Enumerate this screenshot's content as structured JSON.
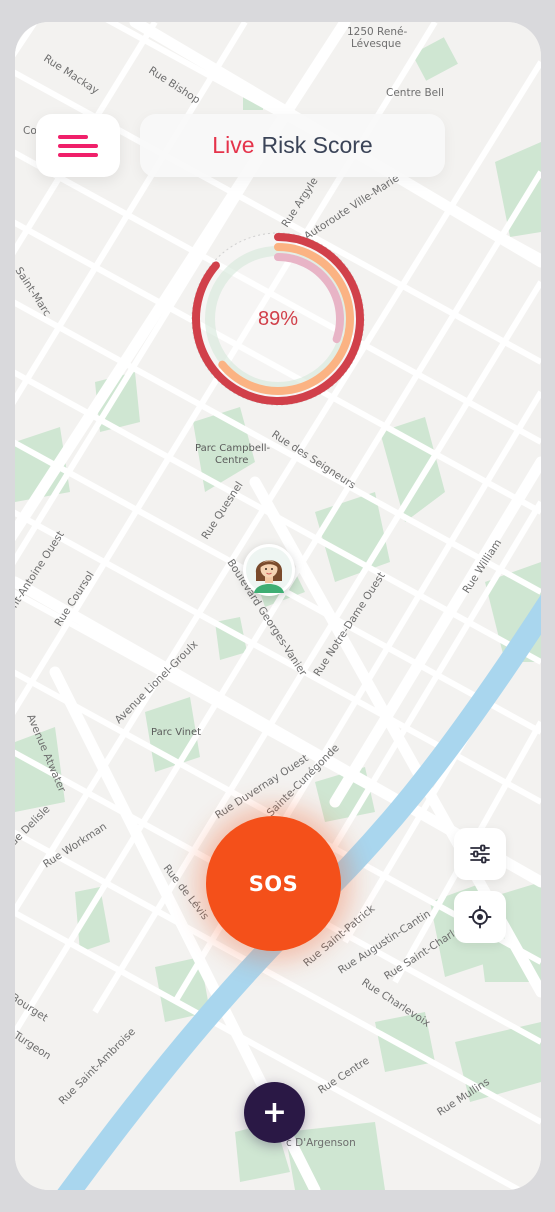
{
  "header": {
    "title_accent": "Live",
    "title_rest": "Risk Score"
  },
  "risk": {
    "value_label": "89%",
    "score_fraction": 0.89,
    "ring_colors": [
      "#d1404a",
      "#fbb383",
      "#e8b4c6"
    ]
  },
  "actions": {
    "sos_label": "SOS",
    "add_label": "+"
  },
  "colors": {
    "accent_pink": "#f0206a",
    "sos_orange": "#f4501a",
    "add_purple": "#2a1845",
    "water": "#a9d6ee",
    "park": "#cfe6d2"
  },
  "icons": {
    "menu": "menu-icon",
    "filter": "sliders-icon",
    "locate": "crosshair-icon",
    "avatar": "user-avatar"
  },
  "map": {
    "labels": {
      "l1250": "1250 René-",
      "levesque": "Lévesque",
      "mackay": "Rue Mackay",
      "bishop": "Rue Bishop",
      "centre_bell": "Centre Bell",
      "co": "Co",
      "argyle": "Rue Argyle",
      "ville_marie": "Autoroute Ville-Marie",
      "saint_marc": "Saint-Marc",
      "campbell1": "Parc Campbell-",
      "campbell2": "Centre",
      "seigneurs": "Rue des Seigneurs",
      "quesnel": "Rue Quesnel",
      "antoine": "Saint-Antoine Ouest",
      "coursol": "Rue Coursol",
      "georges_vanier": "Boulevard Georges-Vanier",
      "notre_dame": "Rue Notre-Dame Ouest",
      "william": "Rue William",
      "lionel_groulx": "Avenue Lionel-Groulx",
      "parc_vinet": "Parc Vinet",
      "atwater": "Avenue Atwater",
      "duvernay": "Rue Duvernay Ouest",
      "cunegonde": "Sainte-Cunégonde",
      "workman": "Rue Workman",
      "delisle": "Rue Delisle",
      "de_levis": "Rue de Lévis",
      "saint_patrick": "Rue Saint-Patrick",
      "augustin": "Rue Augustin-Cantin",
      "saint_charles": "Rue Saint-Charles",
      "charlevoix": "Rue Charlevoix",
      "bourget": "Bourget",
      "turgeon": "Turgeon",
      "saint_ambroise": "Rue Saint-Ambroise",
      "centre": "Rue Centre",
      "mullins": "Rue Mullins",
      "argenson": "c D'Argenson"
    }
  }
}
